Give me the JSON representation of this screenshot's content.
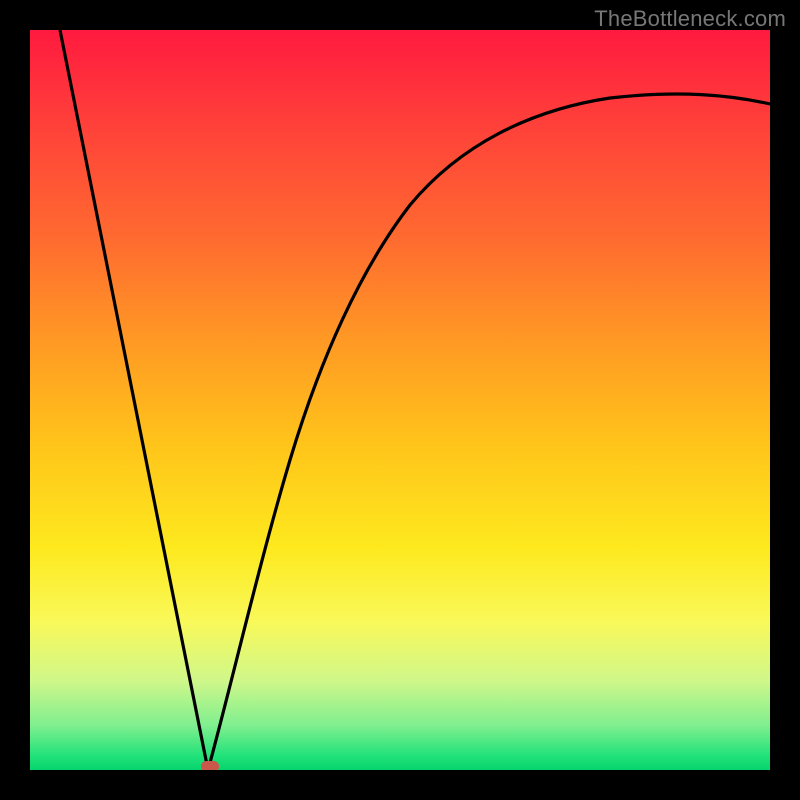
{
  "watermark": "TheBottleneck.com",
  "chart_data": {
    "type": "line",
    "title": "",
    "xlabel": "",
    "ylabel": "",
    "xlim": [
      0,
      100
    ],
    "ylim": [
      0,
      100
    ],
    "grid": false,
    "legend": false,
    "background_gradient": {
      "top_color": "#ff1a3f",
      "bottom_color": "#06d46d",
      "direction": "vertical"
    },
    "series": [
      {
        "name": "left-branch",
        "x": [
          4,
          8,
          12,
          16,
          20,
          24
        ],
        "y": [
          100,
          80,
          60,
          40,
          20,
          0
        ]
      },
      {
        "name": "right-curve",
        "x": [
          24,
          28,
          32,
          36,
          40,
          44,
          48,
          52,
          56,
          60,
          64,
          68,
          72,
          76,
          80,
          84,
          88,
          92,
          96,
          100
        ],
        "y": [
          0,
          17,
          31,
          42,
          51,
          58,
          64,
          69,
          73,
          76,
          79,
          81.5,
          83.5,
          85,
          86.5,
          87.5,
          88.5,
          89,
          89.5,
          90
        ]
      }
    ],
    "marker": {
      "x": 24,
      "y": 0,
      "color": "#d35a4a",
      "shape": "rounded-rect"
    }
  }
}
